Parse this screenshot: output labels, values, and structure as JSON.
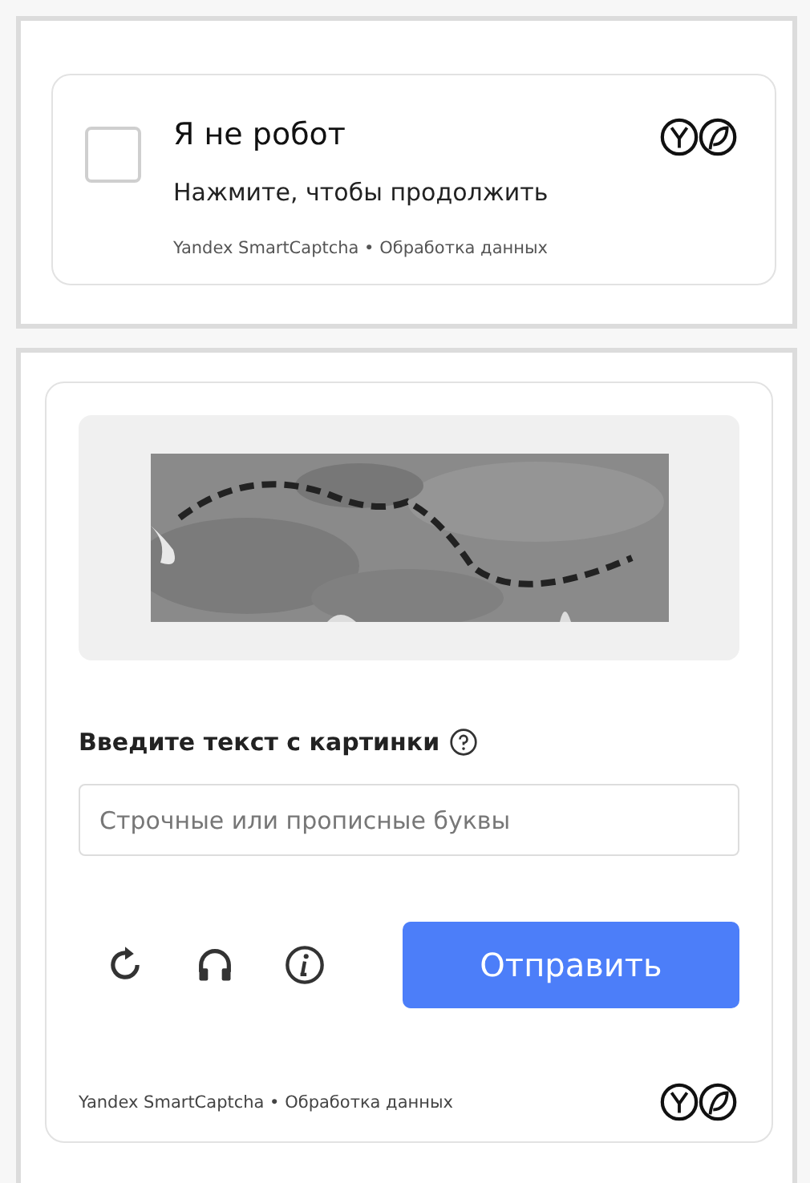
{
  "checkbox_widget": {
    "checked": false,
    "title": "Я не робот",
    "subtitle": "Нажмите, чтобы продолжить",
    "footer": "Yandex SmartCaptcha • Обработка данных"
  },
  "image_widget": {
    "label": "Введите текст с картинки",
    "input": {
      "placeholder": "Строчные или прописные буквы"
    },
    "tools": [
      {
        "kind": "refresh"
      },
      {
        "kind": "audio"
      },
      {
        "kind": "info"
      }
    ],
    "submit_button": "Отправить",
    "footer": "Yandex SmartCaptcha • Обработка данных"
  }
}
